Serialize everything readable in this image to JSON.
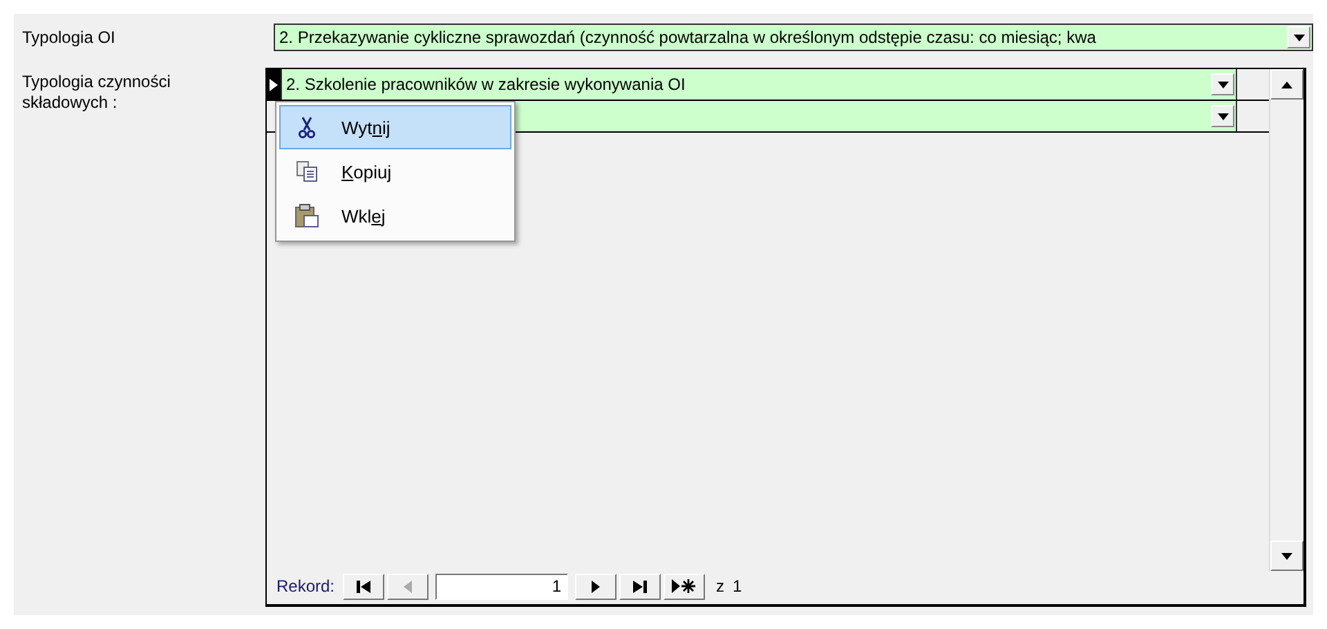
{
  "typologia_oi": {
    "label": "Typologia OI",
    "value": "2. Przekazywanie cykliczne sprawozdań (czynność powtarzalna w określonym odstępie czasu: co miesiąc; kwa"
  },
  "subform": {
    "label": "Typologia czynności składowych :",
    "rows": [
      {
        "value": "2. Szkolenie pracowników w zakresie wykonywania OI",
        "current": true
      },
      {
        "value": "",
        "current": false
      }
    ],
    "navigation": {
      "label": "Rekord:",
      "record": "1",
      "of_label": "z",
      "total": "1"
    }
  },
  "context_menu": {
    "items": [
      {
        "kind": "cut",
        "before": "Wyt",
        "key": "n",
        "after": "ij",
        "selected": true
      },
      {
        "kind": "copy",
        "key": "K",
        "after": "opiuj",
        "selected": false
      },
      {
        "kind": "paste",
        "before": "Wkl",
        "key": "e",
        "after": "j",
        "selected": false
      }
    ]
  }
}
